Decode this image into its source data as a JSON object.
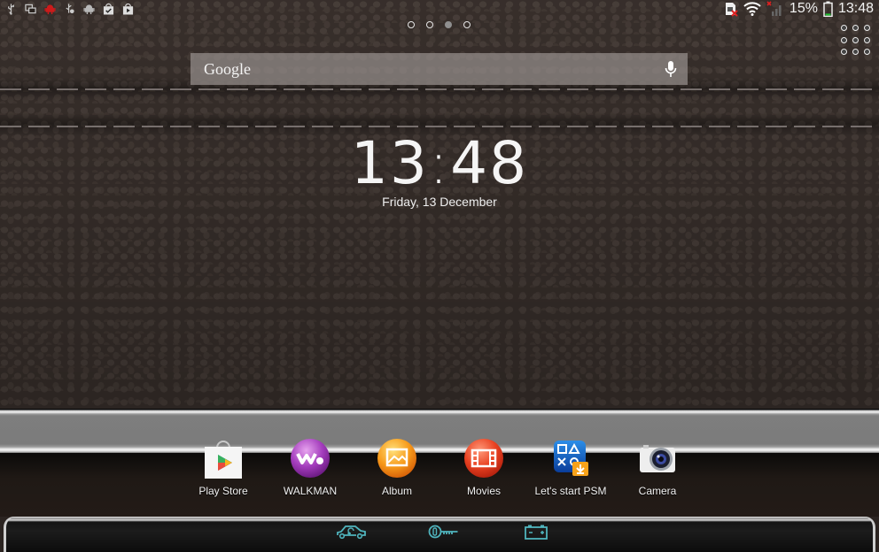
{
  "status_bar": {
    "left_icons": [
      "usb-icon",
      "screen-mirror-icon",
      "android-debug-icon",
      "usb-debugging-icon",
      "android-icon",
      "task-done-icon",
      "play-store-update-icon"
    ],
    "right_icons": [
      "sim-missing-icon",
      "wifi-icon",
      "signal-no-service-icon"
    ],
    "battery_percent": "15%",
    "battery_level": 0.15,
    "time": "13:48",
    "colors": {
      "debug_red": "#cc1b1b",
      "battery_green": "#22c132",
      "error_red": "#e02020"
    }
  },
  "home": {
    "page_count": 4,
    "active_page": 3,
    "apps_button_label": "All apps"
  },
  "search": {
    "logo": "Google",
    "mic_icon": "microphone-icon"
  },
  "clock_widget": {
    "hours": "13",
    "minutes": "48",
    "date": "Friday, 13 December"
  },
  "dock": {
    "apps": [
      {
        "label": "Play Store",
        "icon": "play-store-icon"
      },
      {
        "label": "WALKMAN",
        "icon": "walkman-icon"
      },
      {
        "label": "Album",
        "icon": "album-icon"
      },
      {
        "label": "Movies",
        "icon": "movies-icon"
      },
      {
        "label": "Let's start PSM",
        "icon": "psm-icon"
      },
      {
        "label": "Camera",
        "icon": "camera-icon"
      }
    ]
  },
  "nav_bar": {
    "buttons": [
      {
        "name": "back",
        "icon": "car-back-icon"
      },
      {
        "name": "home",
        "icon": "key-home-icon"
      },
      {
        "name": "recent",
        "icon": "battery-recent-icon"
      }
    ],
    "accent": "#4fb4bd"
  }
}
